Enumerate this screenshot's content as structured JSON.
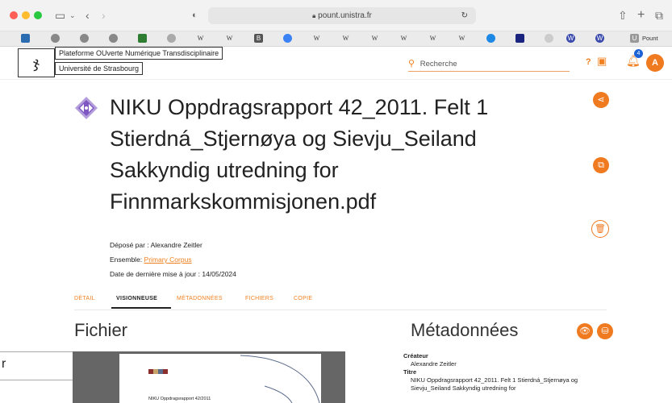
{
  "browser": {
    "url": "pount.unistra.fr",
    "bookmark_label": "Pount",
    "colors": {
      "close": "#ff5f57",
      "min": "#febc2e",
      "max": "#28c840"
    }
  },
  "site": {
    "name_line1": "Plateforme OUverte Numérique Transdisciplinaire",
    "name_line2": "Université de Strasbourg",
    "search_placeholder": "Recherche",
    "help": "?",
    "notif_count": "4",
    "avatar": "A",
    "accent": "#f07a20"
  },
  "document": {
    "title_lines": [
      "NIKU Oppdragsrapport 42_2011. Felt 1",
      "Stierdná_Stjernøya og Sievju_Seiland",
      "Sakkyndig utredning for",
      "Finnmarkskommisjonen.pdf"
    ],
    "deposited_label": "Déposé par : ",
    "deposited_by": "Alexandre Zeitler",
    "set_label": "Ensemble: ",
    "set_value": "Primary Corpus",
    "updated_label": "Date de dernière mise à jour : ",
    "updated_value": "14/05/2024"
  },
  "tabs": [
    "DÉTAIL",
    "VISIONNEUSE",
    "MÉTADONNÉES",
    "FICHIERS",
    "COPIE"
  ],
  "file_section": {
    "heading": "Fichier",
    "page_text": "NIKU Oppdragsrapport 42/2011"
  },
  "metadata_section": {
    "heading": "Métadonnées",
    "creator_label": "Créateur",
    "creator_value": "Alexandre Zeitler",
    "title_label": "Titre",
    "title_value_line1": "NIKU Oppdragsrapport 42_2011. Felt 1 Stierdná_Stjernøya og",
    "title_value_line2": "Sievju_Seiland Sakkyndig utredning for"
  },
  "stray_text": "r"
}
